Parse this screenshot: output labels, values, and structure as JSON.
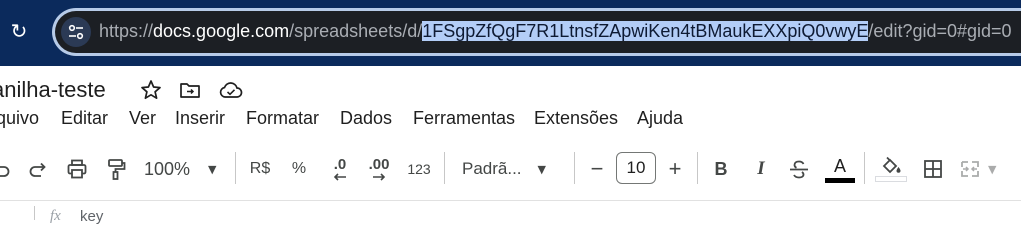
{
  "browser": {
    "url_prefix": "https://",
    "url_host": "docs.google.com",
    "url_path_before": "/spreadsheets/d/",
    "url_selected": "1FSgpZfQgF7R1LtnsfZApwiKen4tBMaukEXXpiQ0vwyE",
    "url_path_after": "/edit?gid=0#gid=0"
  },
  "doc": {
    "title": "anilha-teste"
  },
  "menu": [
    "quivo",
    "Editar",
    "Ver",
    "Inserir",
    "Formatar",
    "Dados",
    "Ferramentas",
    "Extensões",
    "Ajuda"
  ],
  "toolbar": {
    "zoom": "100%",
    "currency": "R$",
    "percent": "%",
    "decrease_decimals": ".0",
    "increase_decimals": ".00",
    "number_format": "123",
    "font": "Padrã...",
    "font_size": "10",
    "minus": "−",
    "plus": "+",
    "bold": "B",
    "italic": "I",
    "text_color_letter": "A"
  },
  "formula_bar": {
    "fx": "fx",
    "value": "key"
  },
  "colors": {
    "browser_bg": "#0b2a5c",
    "selection_bg": "#b3cdf7",
    "text": "#1f1f1f"
  }
}
